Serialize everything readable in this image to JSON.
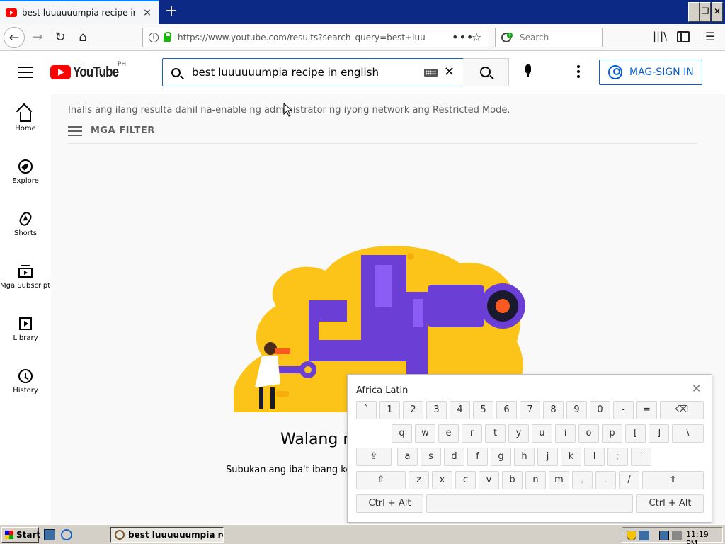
{
  "browser": {
    "tab_title": "best luuuuuumpia recipe in english",
    "tab_close": "×",
    "new_tab": "+",
    "url": "https://www.youtube.com/results?search_query=best+luuuu",
    "page_actions": "•••",
    "bookmark_star": "☆",
    "search_placeholder": "Search",
    "window_min": "_",
    "window_max": "❐",
    "window_close": "✕"
  },
  "youtube": {
    "logo_text": "YouTube",
    "country_code": "PH",
    "search_query": "best luuuuuumpia recipe in english",
    "sign_in_label": "MAG-SIGN IN",
    "guide": [
      {
        "label": "Home",
        "icon": "home-icon"
      },
      {
        "label": "Explore",
        "icon": "compass-icon"
      },
      {
        "label": "Shorts",
        "icon": "shorts-icon"
      },
      {
        "label": "Mga Subscript...",
        "icon": "subscriptions-icon"
      },
      {
        "label": "Library",
        "icon": "library-icon"
      },
      {
        "label": "History",
        "icon": "history-icon"
      }
    ],
    "restricted_notice": "Inalis ang ilang resulta dahil na-enable ng administrator ng iyong network ang Restricted Mode.",
    "filter_label": "MGA FILTER",
    "empty_title": "Walang r",
    "empty_subtitle": "Subukan ang iba't ibang key"
  },
  "onscreen_keyboard": {
    "layout_name": "Africa Latin",
    "close": "✕",
    "rows": [
      [
        "`",
        "1",
        "2",
        "3",
        "4",
        "5",
        "6",
        "7",
        "8",
        "9",
        "0",
        "-",
        "=",
        "⌫"
      ],
      [
        "q",
        "w",
        "e",
        "r",
        "t",
        "y",
        "u",
        "i",
        "o",
        "p",
        "[",
        "]",
        "\\"
      ],
      [
        "⇪",
        "a",
        "s",
        "d",
        "f",
        "g",
        "h",
        "j",
        "k",
        "l",
        ";",
        "'"
      ],
      [
        "⇧",
        "z",
        "x",
        "c",
        "v",
        "b",
        "n",
        "m",
        ",",
        ".",
        "/",
        "⇧"
      ],
      [
        "Ctrl + Alt",
        " ",
        "Ctrl + Alt"
      ]
    ]
  },
  "taskbar": {
    "start_label": "Start",
    "task_item": "best luuuuuumpia rec...",
    "clock": "11:19 PM"
  },
  "colors": {
    "youtube_red": "#ff0000",
    "link_blue": "#065fd4",
    "firefox_tab_accent": "#0a84ff",
    "illustration_yellow": "#fcc419",
    "illustration_purple": "#6b3fd6"
  }
}
